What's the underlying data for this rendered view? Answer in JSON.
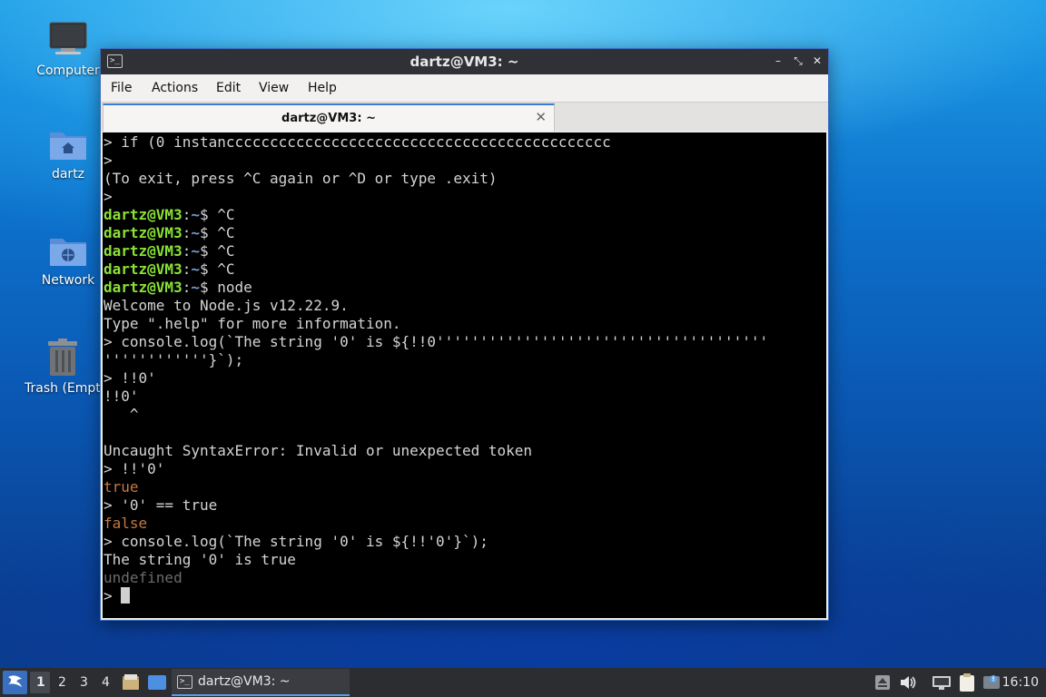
{
  "desktop": {
    "icons": [
      {
        "label": "Computer"
      },
      {
        "label": "dartz"
      },
      {
        "label": "Network"
      },
      {
        "label": "Trash (Empty)"
      }
    ]
  },
  "window": {
    "title": "dartz@VM3: ~",
    "controls": {
      "minimize": "–",
      "maximize": "⤡",
      "close": "✕"
    },
    "menu": [
      "File",
      "Actions",
      "Edit",
      "View",
      "Help"
    ],
    "tab": {
      "label": "dartz@VM3: ~",
      "close": "✕"
    }
  },
  "terminal": {
    "prompt_user": "dartz@VM3",
    "prompt_colon": ":",
    "prompt_path": "~",
    "prompt_dollar": "$ ",
    "lines": [
      "> if (0 instancccccccccccccccccccccccccccccccccccccccccccc",
      ">",
      "(To exit, press ^C again or ^D or type .exit)",
      ">",
      "^C",
      "^C",
      "^C",
      "^C",
      "node",
      "Welcome to Node.js v12.22.9.",
      "Type \".help\" for more information.",
      "> console.log(`The string '0' is ${!!0''''''''''''''''''''''''''''''''''''''",
      "''''''''''''}`);",
      "> !!0'",
      "!!0'",
      "   ^",
      "",
      "Uncaught SyntaxError: Invalid or unexpected token",
      "> !!'0'",
      "true",
      "> '0' == true",
      "false",
      "> console.log(`The string '0' is ${!!'0'}`);",
      "The string '0' is true",
      "undefined",
      "> "
    ]
  },
  "taskbar": {
    "workspaces": [
      "1",
      "2",
      "3",
      "4"
    ],
    "task_label": "dartz@VM3: ~",
    "clock": "16:10"
  }
}
